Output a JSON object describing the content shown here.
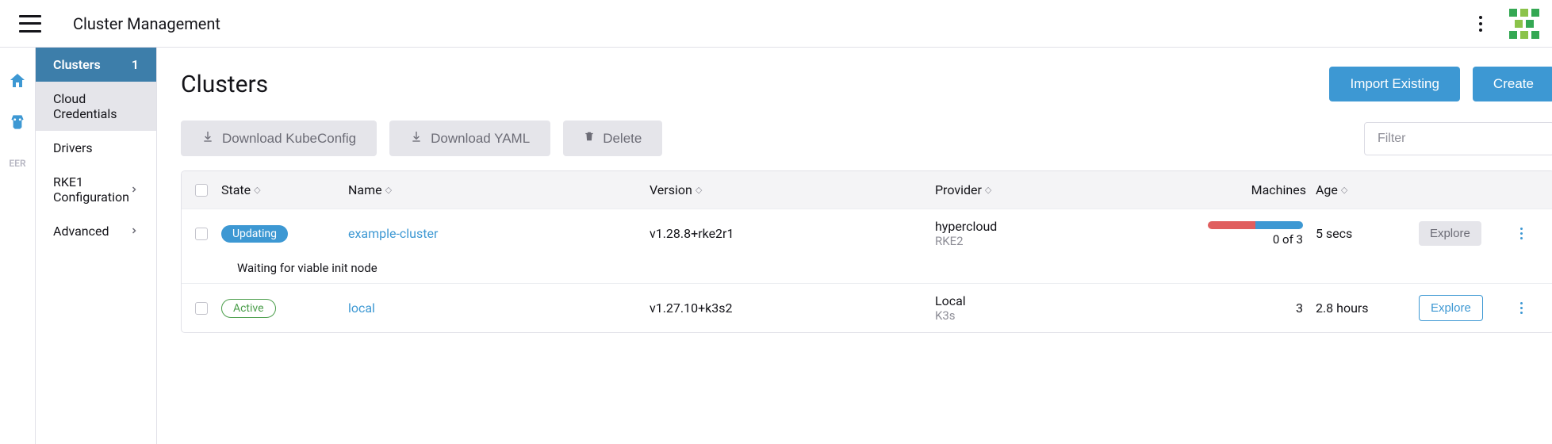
{
  "header": {
    "title": "Cluster Management"
  },
  "sidebar": {
    "items": [
      {
        "label": "Clusters",
        "badge": "1"
      },
      {
        "label": "Cloud Credentials"
      },
      {
        "label": "Drivers"
      },
      {
        "label": "RKE1 Configuration",
        "chevron": true
      },
      {
        "label": "Advanced",
        "chevron": true
      }
    ]
  },
  "rail": {
    "eer_label": "EER"
  },
  "page": {
    "title": "Clusters",
    "import_label": "Import Existing",
    "create_label": "Create"
  },
  "toolbar": {
    "download_kubeconfig": "Download KubeConfig",
    "download_yaml": "Download YAML",
    "delete": "Delete",
    "filter_placeholder": "Filter"
  },
  "table": {
    "headers": {
      "state": "State",
      "name": "Name",
      "version": "Version",
      "provider": "Provider",
      "machines": "Machines",
      "age": "Age"
    },
    "rows": [
      {
        "status": "Updating",
        "status_class": "pill-updating",
        "name": "example-cluster",
        "version": "v1.28.8+rke2r1",
        "provider": "hypercloud",
        "provider_sub": "RKE2",
        "machines_text": "0 of 3",
        "machines_bar": {
          "red": 50,
          "blue": 50
        },
        "age": "5 secs",
        "explore_class": "explore-grey",
        "explore_label": "Explore",
        "sub_message": "Waiting for viable init node"
      },
      {
        "status": "Active",
        "status_class": "pill-active",
        "name": "local",
        "version": "v1.27.10+k3s2",
        "provider": "Local",
        "provider_sub": "K3s",
        "machines_text": "3",
        "age": "2.8 hours",
        "explore_class": "explore-outline",
        "explore_label": "Explore"
      }
    ]
  }
}
